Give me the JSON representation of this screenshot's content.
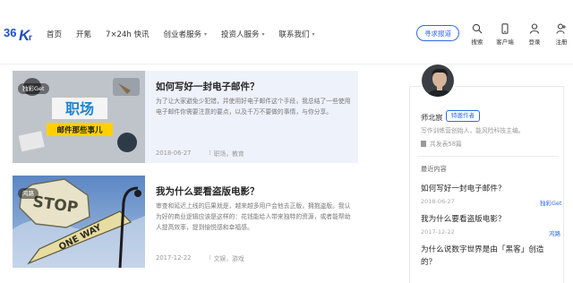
{
  "header": {
    "logo_text": "36Kr",
    "nav": [
      {
        "label": "首页",
        "dropdown": false
      },
      {
        "label": "开氪",
        "dropdown": false
      },
      {
        "label": "7×24h 快讯",
        "dropdown": false
      },
      {
        "label": "创业者服务",
        "dropdown": true
      },
      {
        "label": "投资人服务",
        "dropdown": true
      },
      {
        "label": "联系我们",
        "dropdown": true
      }
    ],
    "seek_report": "寻求报道",
    "tools": {
      "search": "搜索",
      "client": "客户端",
      "login": "登录",
      "register": "注册"
    }
  },
  "articles": [
    {
      "badge": "独彩Get",
      "title": "如何写好一封电子邮件？",
      "summary": "为了让大家避免少犯错，并使用好电子邮件这个手段，我总结了一些使用电子邮件你需要注意的要点，以及千万不要做的事情，与你分享。",
      "date": "2018-06-27",
      "tags": "职场，教育",
      "thumb_text_1": "职场",
      "thumb_text_2": "邮件那些事儿"
    },
    {
      "badge": "鸿路",
      "title": "我为什么要看盗版电影？",
      "summary": "审查和延迟上线的后果就是，越来越多用户会他去正版，拥抱盗版。我认为好的商业逻辑应该是这样的：花钱能给人带来独特的资源，或者能帮助人提高效率，提到愉悦感和幸福感。",
      "date": "2017-12-22",
      "tags": "文娱，游戏",
      "thumb_text_1": "STOP",
      "thumb_text_2": "ONE WAY"
    }
  ],
  "author": {
    "name": "师北宸",
    "badge": "特邀作者",
    "description": "写作训练营创始人，能风险科技主编。",
    "count": "共发表58篇"
  },
  "recent": {
    "heading": "最近内容",
    "items": [
      {
        "title": "如何写好一封电子邮件？",
        "date": "2018-06-27",
        "tag": "独彩Get"
      },
      {
        "title": "我为什么要看盗版电影？",
        "date": "2017-12-22",
        "tag": "鸿路"
      },
      {
        "title": "为什么说数字世界是由「黑客」创造的？",
        "date": "",
        "tag": ""
      }
    ]
  },
  "colors": {
    "accent": "#2e6be6",
    "card_highlight": "#eef2fa"
  }
}
